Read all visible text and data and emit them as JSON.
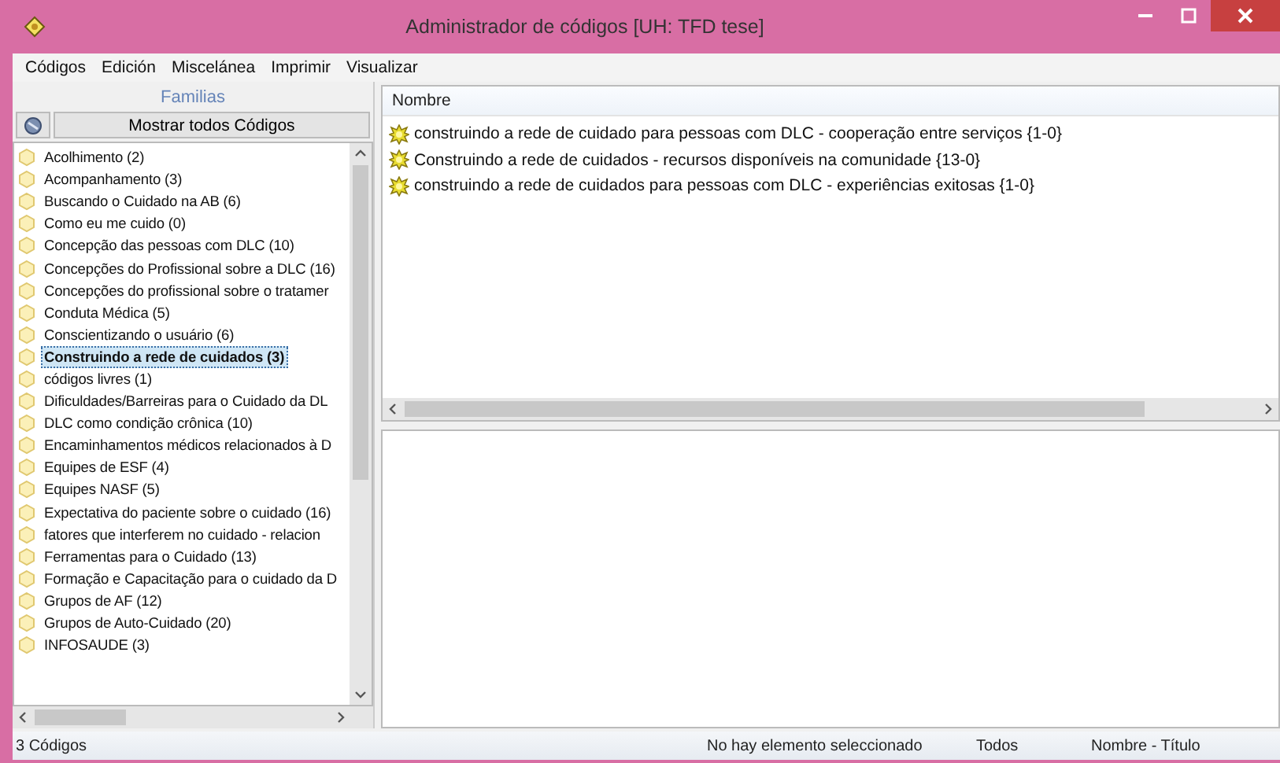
{
  "window": {
    "title": "Administrador de códigos [UH: TFD tese]"
  },
  "menu": [
    "Códigos",
    "Edición",
    "Miscelánea",
    "Imprimir",
    "Visualizar"
  ],
  "families": {
    "title": "Familias",
    "show_all_button": "Mostrar todos Códigos",
    "items": [
      {
        "label": "Acolhimento (2)",
        "selected": false
      },
      {
        "label": "Acompanhamento (3)",
        "selected": false
      },
      {
        "label": "Buscando o Cuidado na AB (6)",
        "selected": false
      },
      {
        "label": "Como eu me cuido (0)",
        "selected": false
      },
      {
        "label": "Concepção das pessoas com DLC (10)",
        "selected": false
      },
      {
        "label": "Concepções do Profissional sobre a DLC (16)",
        "selected": false
      },
      {
        "label": "Concepções do profissional sobre o tratamer",
        "selected": false
      },
      {
        "label": "Conduta Médica (5)",
        "selected": false
      },
      {
        "label": "Conscientizando o usuário (6)",
        "selected": false
      },
      {
        "label": "Construindo a rede de cuidados (3)",
        "selected": true
      },
      {
        "label": "códigos livres (1)",
        "selected": false
      },
      {
        "label": "Dificuldades/Barreiras para o Cuidado da DL",
        "selected": false
      },
      {
        "label": "DLC como condição crônica (10)",
        "selected": false
      },
      {
        "label": "Encaminhamentos médicos relacionados à D",
        "selected": false
      },
      {
        "label": "Equipes de ESF (4)",
        "selected": false
      },
      {
        "label": "Equipes NASF (5)",
        "selected": false
      },
      {
        "label": "Expectativa do paciente sobre o cuidado (16)",
        "selected": false
      },
      {
        "label": "fatores que interferem no cuidado - relacion",
        "selected": false
      },
      {
        "label": "Ferramentas para o Cuidado (13)",
        "selected": false
      },
      {
        "label": "Formação e Capacitação para o cuidado da D",
        "selected": false
      },
      {
        "label": "Grupos de AF (12)",
        "selected": false
      },
      {
        "label": "Grupos de Auto-Cuidado (20)",
        "selected": false
      },
      {
        "label": "INFOSAUDE (3)",
        "selected": false
      }
    ]
  },
  "codes": {
    "column": "Nombre",
    "rows": [
      "construindo a rede de cuidado para pessoas com DLC - cooperação entre serviços {1-0}",
      "Construindo a rede de cuidados - recursos disponíveis na comunidade {13-0}",
      "construindo a rede de cuidados para pessoas com DLC - experiências exitosas {1-0}"
    ]
  },
  "status_bar": [
    "3 Códigos",
    "No hay elemento seleccionado",
    "Todos",
    "Nombre - Título"
  ]
}
